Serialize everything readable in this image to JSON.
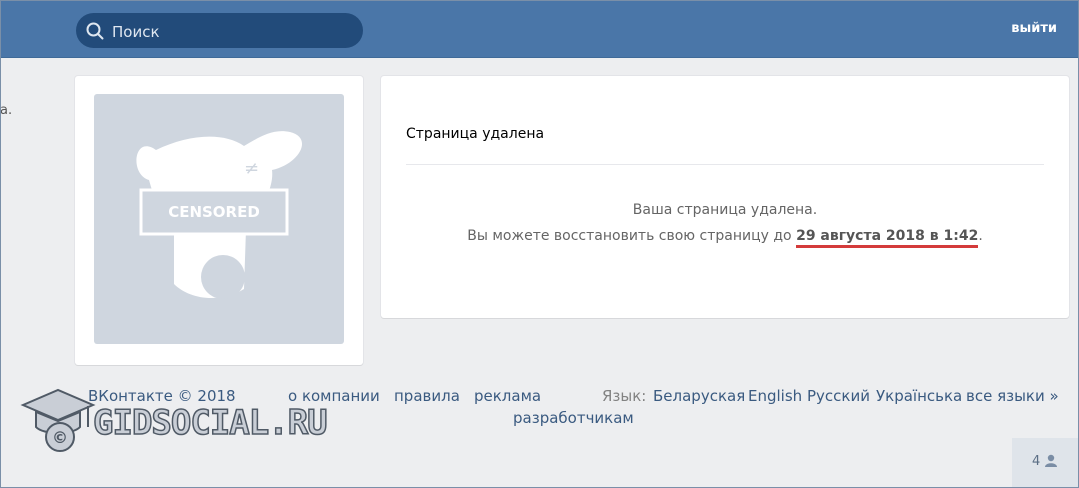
{
  "header": {
    "search_placeholder": "Поиск",
    "logout_label": "выйти"
  },
  "left_fragment": "a.",
  "avatar": {
    "stamp_text": "CENSORED"
  },
  "page": {
    "title": "Страница удалена",
    "message_line1": "Ваша страница удалена.",
    "message_line2_prefix": "Вы можете восстановить свою страницу до ",
    "restore_date": "29 августа 2018 в 1:42",
    "message_line2_suffix": "."
  },
  "footer": {
    "copyright": "ВКонтакте © 2018",
    "links": [
      "о компании",
      "правила",
      "реклама",
      "разработчикам"
    ],
    "language_label": "Язык:",
    "languages": [
      "Беларуская",
      "English",
      "Русский",
      "Українська",
      "все языки »"
    ]
  },
  "online_counter": "4",
  "watermark_text": "GIDSOCIAL.RU",
  "colors": {
    "header": "#4a76a8",
    "search": "#224b7a",
    "underline": "#d43b3b",
    "background": "#edeef0"
  }
}
